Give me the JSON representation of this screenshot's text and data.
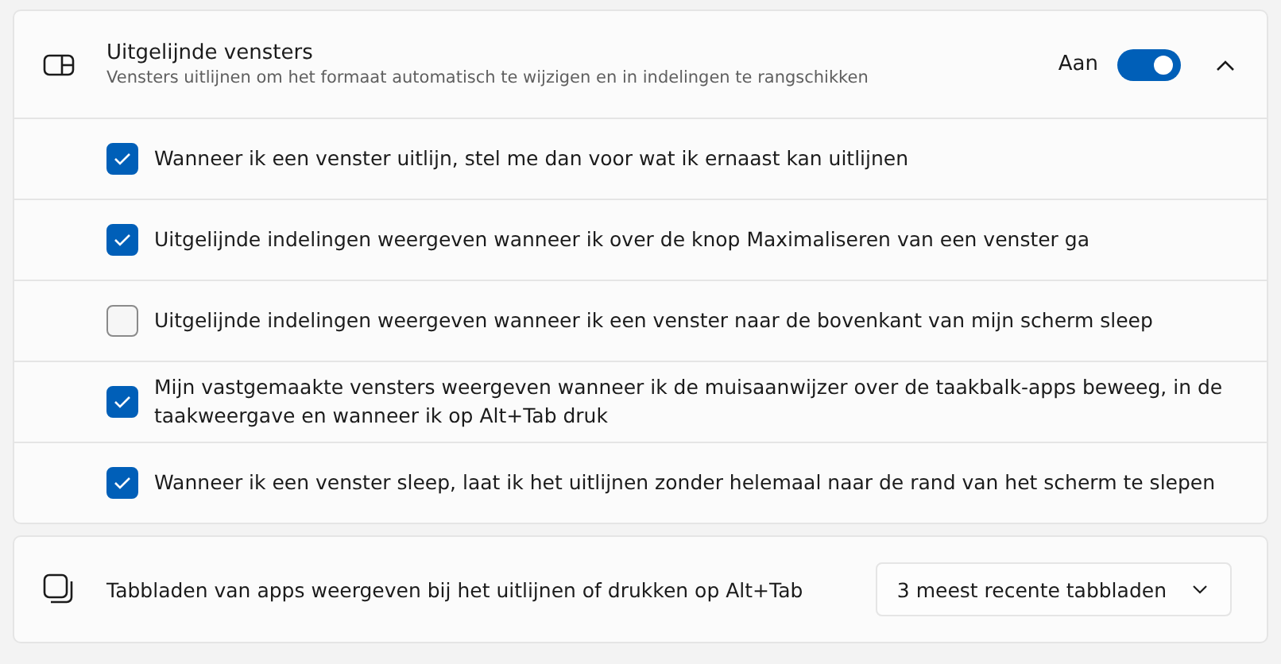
{
  "snap_section": {
    "title": "Uitgelijnde vensters",
    "description": "Vensters uitlijnen om het formaat automatisch te wijzigen en in indelingen te rangschikken",
    "toggle_label": "Aan",
    "on": true,
    "expanded": true,
    "options": [
      {
        "label": "Wanneer ik een venster uitlijn, stel me dan voor wat ik ernaast kan uitlijnen",
        "checked": true
      },
      {
        "label": "Uitgelijnde indelingen weergeven wanneer ik over de knop Maximaliseren van een venster ga",
        "checked": true
      },
      {
        "label": "Uitgelijnde indelingen weergeven wanneer ik een venster naar de bovenkant van mijn scherm sleep",
        "checked": false
      },
      {
        "label": "Mijn vastgemaakte vensters weergeven wanneer ik de muisaanwijzer over de taakbalk-apps beweeg, in de taakweergave en wanneer ik op Alt+Tab druk",
        "checked": true
      },
      {
        "label": "Wanneer ik een venster sleep, laat ik het uitlijnen zonder helemaal naar de rand van het scherm te slepen",
        "checked": true
      }
    ]
  },
  "tabs_setting": {
    "label": "Tabbladen van apps weergeven bij het uitlijnen of drukken op Alt+Tab",
    "value": "3 meest recente tabbladen"
  }
}
